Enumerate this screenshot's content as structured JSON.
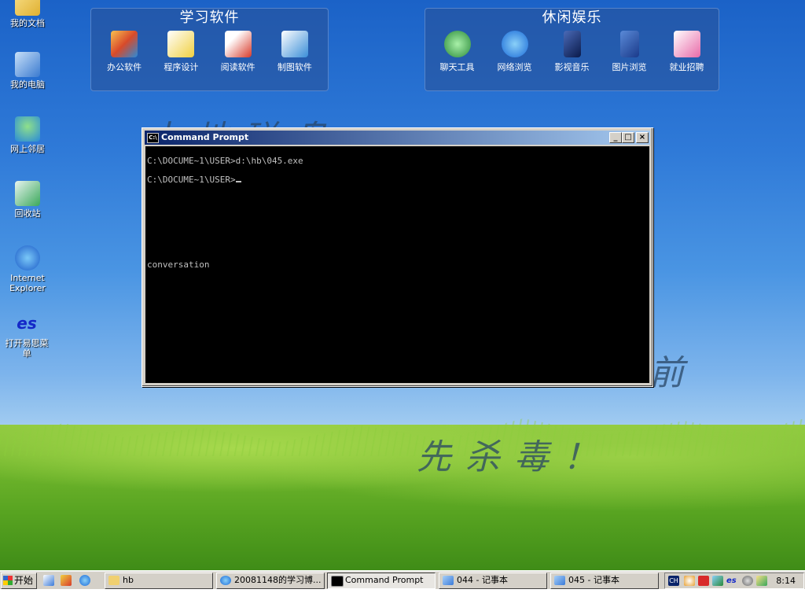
{
  "desktop": {
    "icons": [
      {
        "label": "我的文档",
        "icon": "my-documents-icon"
      },
      {
        "label": "我的电脑",
        "icon": "my-computer-icon"
      },
      {
        "label": "网上邻居",
        "icon": "network-places-icon"
      },
      {
        "label": "回收站",
        "icon": "recycle-bin-icon"
      },
      {
        "label_line1": "Internet",
        "label_line2": "Explorer",
        "icon": "internet-explorer-icon"
      },
      {
        "label_line1": "打开易思菜",
        "label_line2": "单",
        "icon": "es-menu-icon",
        "glyph": "es"
      }
    ],
    "wallpaper_text": [
      "本地磁盘",
      "前",
      "先杀毒！"
    ]
  },
  "panels": {
    "study": {
      "title": "学习软件",
      "items": [
        {
          "label": "办公软件",
          "icon": "office-software-icon",
          "color": "#e8a030"
        },
        {
          "label": "程序设计",
          "icon": "programming-icon",
          "color": "#f0d040"
        },
        {
          "label": "阅读软件",
          "icon": "pdf-reader-icon",
          "color": "#d83a2a"
        },
        {
          "label": "制图软件",
          "icon": "drawing-software-icon",
          "color": "#3a8ed8"
        }
      ]
    },
    "leisure": {
      "title": "休闲娱乐",
      "items": [
        {
          "label": "聊天工具",
          "icon": "chat-tools-icon",
          "color": "#4aa84a"
        },
        {
          "label": "网络浏览",
          "icon": "web-browser-icon",
          "color": "#2a7ad8"
        },
        {
          "label": "影视音乐",
          "icon": "media-music-icon",
          "color": "#1a3a8a"
        },
        {
          "label": "图片浏览",
          "icon": "picture-viewer-icon",
          "color": "#2a5ab8"
        },
        {
          "label": "就业招聘",
          "icon": "jobs-icon",
          "color": "#e86aa8"
        }
      ]
    }
  },
  "cmd_window": {
    "title": "Command Prompt",
    "title_icon_text": "C:\\",
    "lines": [
      "C:\\DOCUME~1\\USER>d:\\hb\\045.exe",
      "C:\\DOCUME~1\\USER>",
      "conversation"
    ],
    "buttons": {
      "minimize": "_",
      "maximize": "□",
      "close": "×"
    }
  },
  "taskbar": {
    "start_label": "开始",
    "tasks": [
      {
        "label": "hb",
        "icon": "folder-icon",
        "active": false
      },
      {
        "label": "20081148的学习博...",
        "icon": "internet-explorer-icon",
        "active": false
      },
      {
        "label": "Command Prompt",
        "icon": "cmd-icon",
        "active": true
      },
      {
        "label": "044 - 记事本",
        "icon": "notepad-icon",
        "active": false
      },
      {
        "label": "045 - 记事本",
        "icon": "notepad-icon",
        "active": false
      }
    ],
    "tray": {
      "ime_label": "CH",
      "es_label": "es",
      "clock": "8:14"
    }
  }
}
